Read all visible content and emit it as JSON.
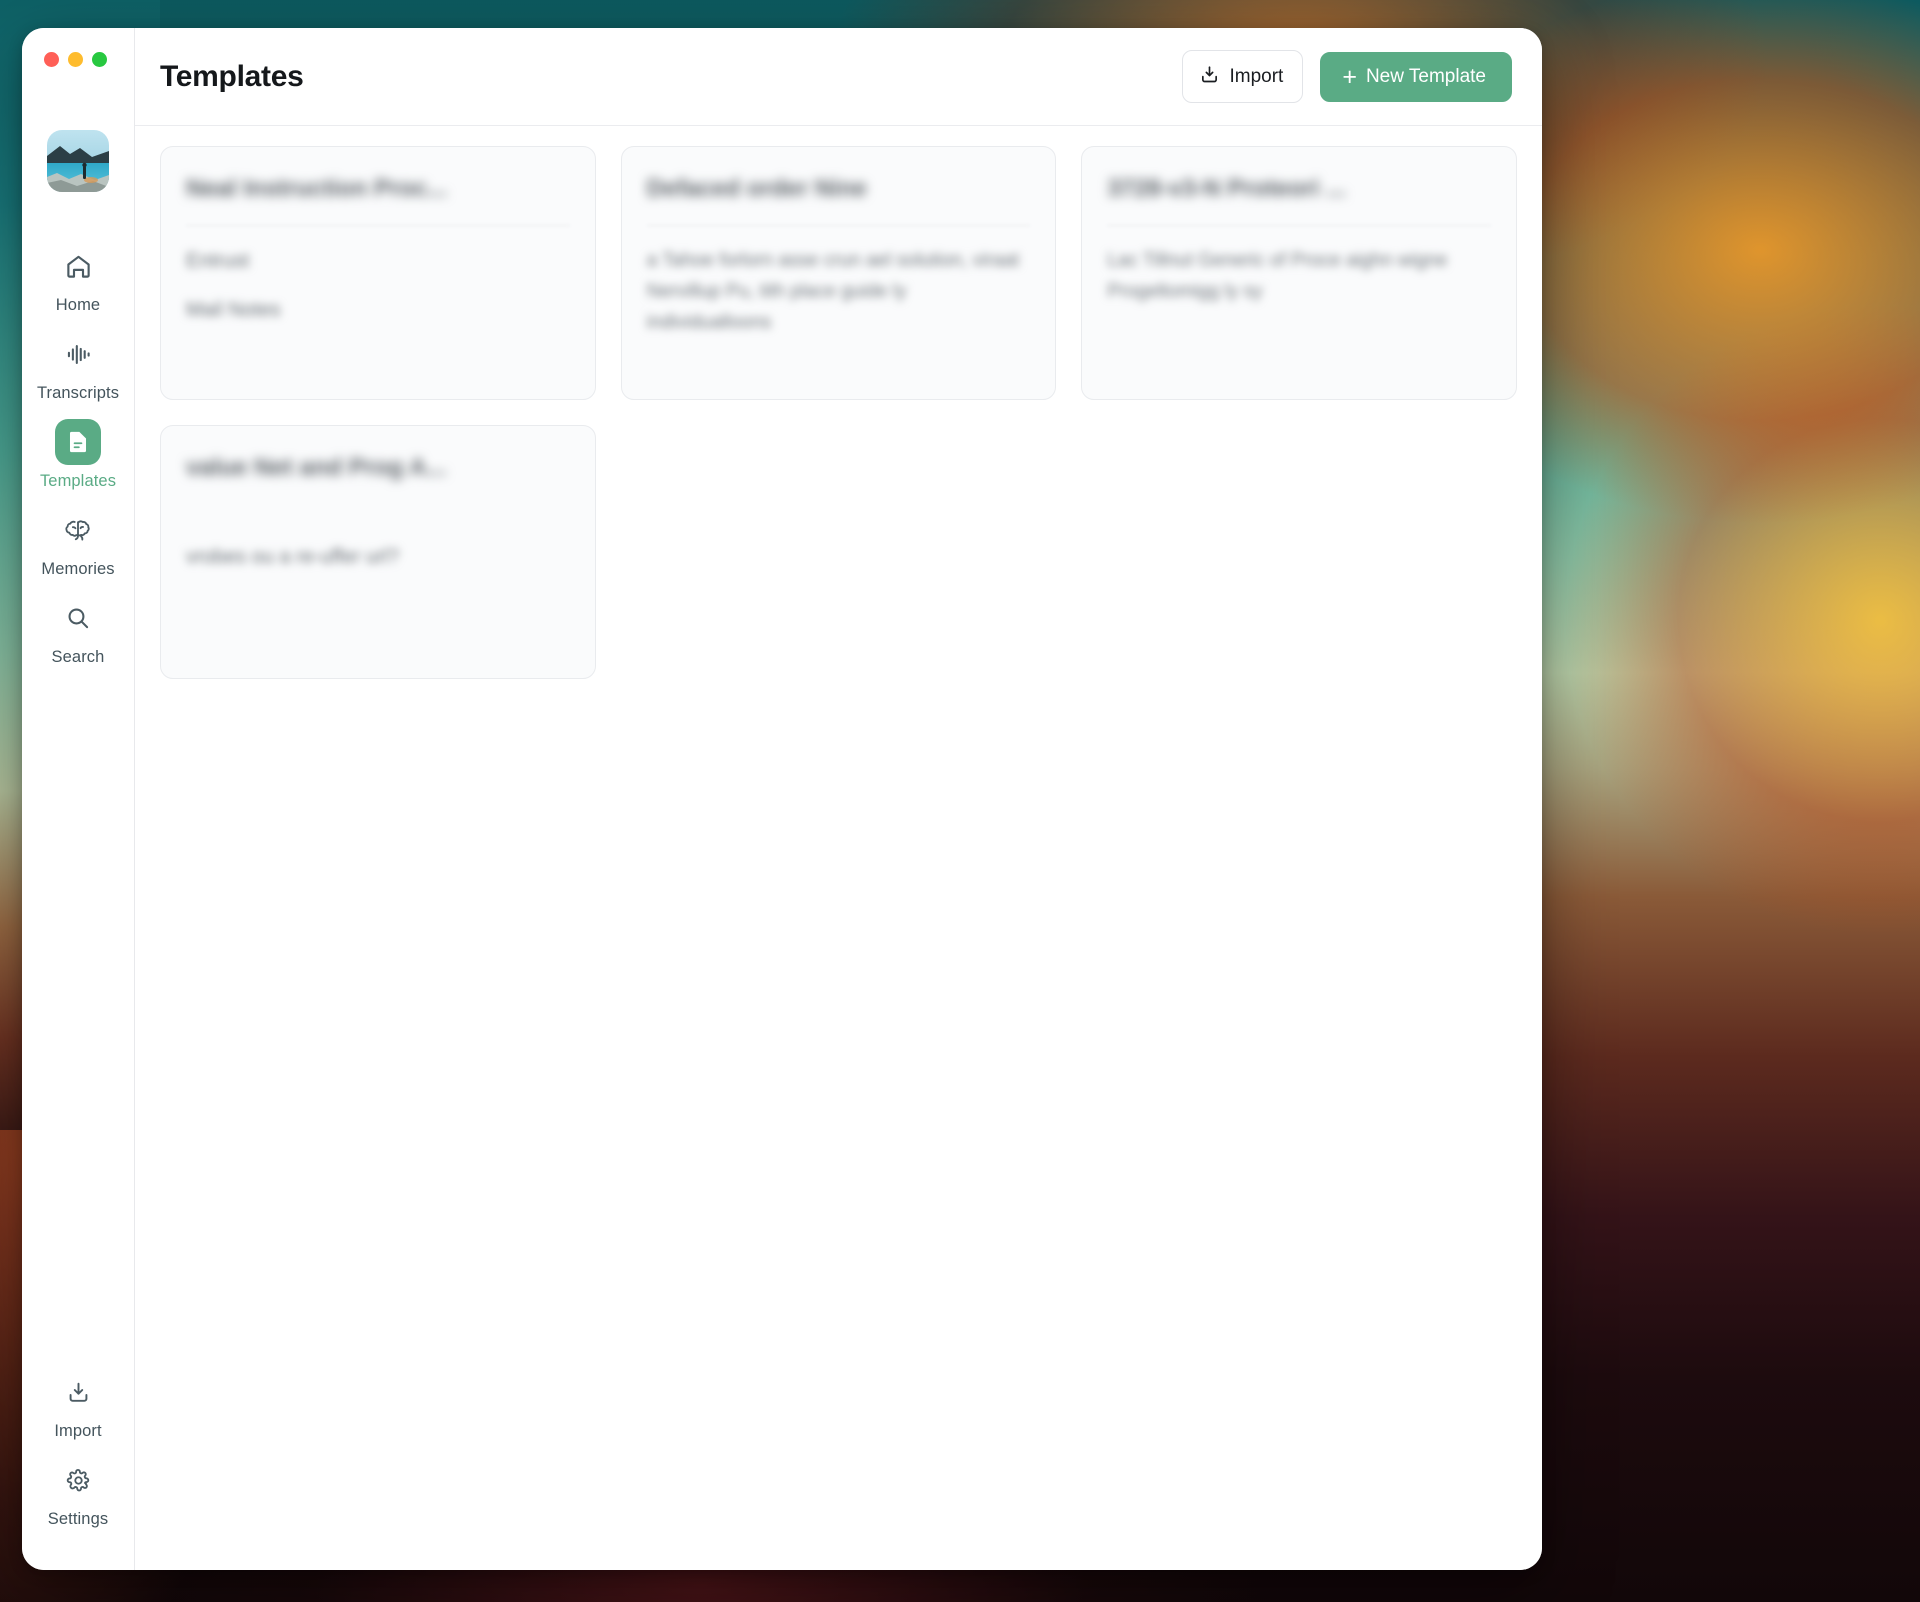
{
  "window": {
    "traffic_lights": [
      {
        "name": "close",
        "color": "#ff5f57"
      },
      {
        "name": "minimize",
        "color": "#febc2e"
      },
      {
        "name": "maximize",
        "color": "#28c840"
      }
    ]
  },
  "theme": {
    "accent": "#5aab85",
    "text_primary": "#15181b",
    "text_muted": "#44545c",
    "card_bg": "#fafbfc",
    "border": "#e9ebee"
  },
  "sidebar": {
    "avatar": {
      "name": "user-avatar",
      "alt": "lake landscape photo"
    },
    "items": [
      {
        "id": "home",
        "label": "Home",
        "icon": "home-icon",
        "active": false
      },
      {
        "id": "transcripts",
        "label": "Transcripts",
        "icon": "waveform-icon",
        "active": false
      },
      {
        "id": "templates",
        "label": "Templates",
        "icon": "document-icon",
        "active": true
      },
      {
        "id": "memories",
        "label": "Memories",
        "icon": "brain-icon",
        "active": false
      },
      {
        "id": "search",
        "label": "Search",
        "icon": "search-icon",
        "active": false
      }
    ],
    "bottom_items": [
      {
        "id": "import",
        "label": "Import",
        "icon": "download-icon",
        "active": false
      },
      {
        "id": "settings",
        "label": "Settings",
        "icon": "gear-icon",
        "active": false
      }
    ]
  },
  "header": {
    "title": "Templates",
    "import_label": "Import",
    "new_template_label": "New Template",
    "new_template_plus": "+"
  },
  "templates": [
    {
      "title_redacted": "Neal Instruction Proc...",
      "has_divider": true,
      "lines": [
        "Entrust",
        "Mail Notes"
      ],
      "body_redacted": ""
    },
    {
      "title_redacted": "Defaced order Nine",
      "has_divider": true,
      "lines": [],
      "body_redacted": "a Tahoe forlorn asse crun ael solution, viraat Nervillup Pu, tith place guide ly individualloons"
    },
    {
      "title_redacted": "3728-v3-N Proteori ...",
      "has_divider": true,
      "lines": [],
      "body_redacted": "Lac Tillnut Generic of Proce aighn wigne Progeltomigg ly sy"
    },
    {
      "title_redacted": "value Net and Prog A...",
      "has_divider": false,
      "lines": [
        "vrobes ou a re-uffer url?"
      ],
      "body_redacted": ""
    }
  ]
}
